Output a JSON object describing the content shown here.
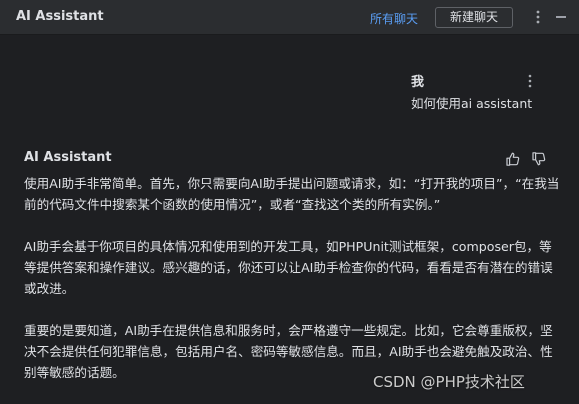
{
  "header": {
    "title": "AI Assistant",
    "all_chats_label": "所有聊天",
    "new_chat_label": "新建聊天"
  },
  "user_message": {
    "author": "我",
    "text": "如何使用ai assistant"
  },
  "assistant_message": {
    "author": "AI Assistant",
    "paragraphs": [
      "使用AI助手非常简单。首先，你只需要向AI助手提出问题或请求，如：“打开我的项目”，“在我当前的代码文件中搜索某个函数的使用情况”，或者“查找这个类的所有实例。”",
      "AI助手会基于你项目的具体情况和使用到的开发工具，如PHPUnit测试框架，composer包，等等提供答案和操作建议。感兴趣的话，你还可以让AI助手检查你的代码，看看是否有潜在的错误或改进。",
      "重要的是要知道，AI助手在提供信息和服务时，会严格遵守一些规定。比如，它会尊重版权，坚决不会提供任何犯罪信息，包括用户名、密码等敏感信息。而且，AI助手也会避免触及政治、性别等敏感的话题。"
    ]
  },
  "watermark": "CSDN @PHP技术社区",
  "icons": {
    "header_more": "more-vertical-icon",
    "header_minimize": "minimize-icon",
    "message_more": "more-vertical-icon",
    "thumbs_up": "thumbs-up-icon",
    "thumbs_down": "thumbs-down-icon"
  },
  "colors": {
    "background": "#1e1f22",
    "header_background": "#2b2d30",
    "link": "#5a9ef5",
    "text": "#dfe1e5"
  }
}
